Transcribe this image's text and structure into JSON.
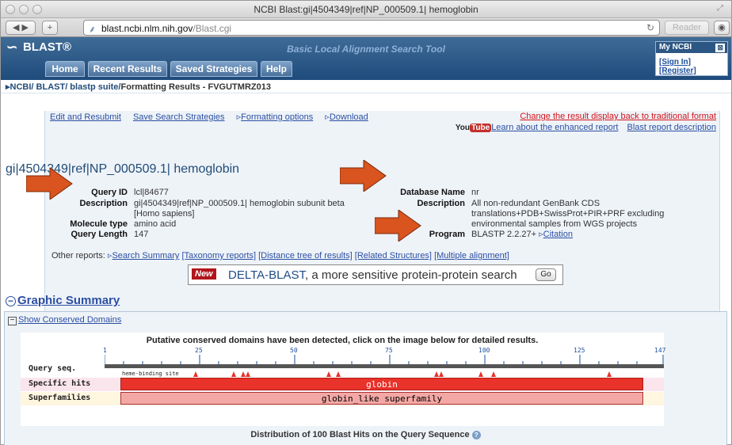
{
  "window": {
    "title": "NCBI Blast:gi|4504349|ref|NP_000509.1| hemoglobin"
  },
  "browser": {
    "url_host": "blast.ncbi.nlm.nih.gov",
    "url_path": "/Blast.cgi",
    "reader_label": "Reader"
  },
  "header": {
    "logo": "BLAST®",
    "subtitle": "Basic Local Alignment Search Tool",
    "tabs": [
      {
        "label": "Home"
      },
      {
        "label": "Recent Results"
      },
      {
        "label": "Saved Strategies"
      },
      {
        "label": "Help"
      }
    ],
    "myncbi": {
      "title": "My NCBI",
      "close": "⊠",
      "links": "[Sign In] [Register]"
    }
  },
  "breadcrumb": {
    "parts": "NCBI/ BLAST/ blastp suite/",
    "current": "Formatting Results - FVGUTMRZ013"
  },
  "actions": {
    "edit": "Edit and Resubmit",
    "save": "Save Search Strategies",
    "formatting": "Formatting options",
    "download": "Download",
    "change_display": "Change the result display back to traditional format",
    "youtube_you": "You",
    "youtube_tube": "Tube",
    "learn": "Learn about the enhanced report",
    "report_desc": "Blast report description"
  },
  "result_title": "gi|4504349|ref|NP_000509.1| hemoglobin",
  "query": {
    "id_label": "Query ID",
    "id": "lcl|84677",
    "desc_label": "Description",
    "desc": "gi|4504349|ref|NP_000509.1| hemoglobin subunit beta [Homo sapiens]",
    "moltype_label": "Molecule type",
    "moltype": "amino acid",
    "length_label": "Query Length",
    "length": "147"
  },
  "database": {
    "name_label": "Database Name",
    "name": "nr",
    "desc_label": "Description",
    "desc": "All non-redundant GenBank CDS translations+PDB+SwissProt+PIR+PRF excluding environmental samples from WGS projects",
    "program_label": "Program",
    "program": "BLASTP 2.2.27+",
    "citation": "Citation"
  },
  "other_reports": {
    "label": "Other reports:",
    "links": [
      "Search Summary",
      "[Taxonomy reports]",
      "[Distance tree of results]",
      "[Related Structures]",
      "[Multiple alignment]"
    ]
  },
  "delta": {
    "badge": "New",
    "name": "DELTA-BLAST",
    "rest": ", a more sensitive protein-protein search",
    "go": "Go"
  },
  "graphic": {
    "title": "Graphic Summary",
    "show_domains": "Show Conserved Domains",
    "putative": "Putative conserved domains have been detected, click on the image below for detailed results.",
    "ticks": [
      "1",
      "25",
      "50",
      "75",
      "100",
      "125",
      "147"
    ],
    "query_seq": "Query seq.",
    "heme": "heme-binding site",
    "specific": "Specific hits",
    "superfamilies": "Superfamilies",
    "specific_name": "globin",
    "super_name": "globin_like superfamily",
    "distribution": "Distribution of 100 Blast Hits on the Query Sequence"
  },
  "colors": {
    "accent": "#1f4b7c",
    "specific": "#e8322a",
    "super": "#f4a8a5",
    "arrow": "#d9541e"
  }
}
